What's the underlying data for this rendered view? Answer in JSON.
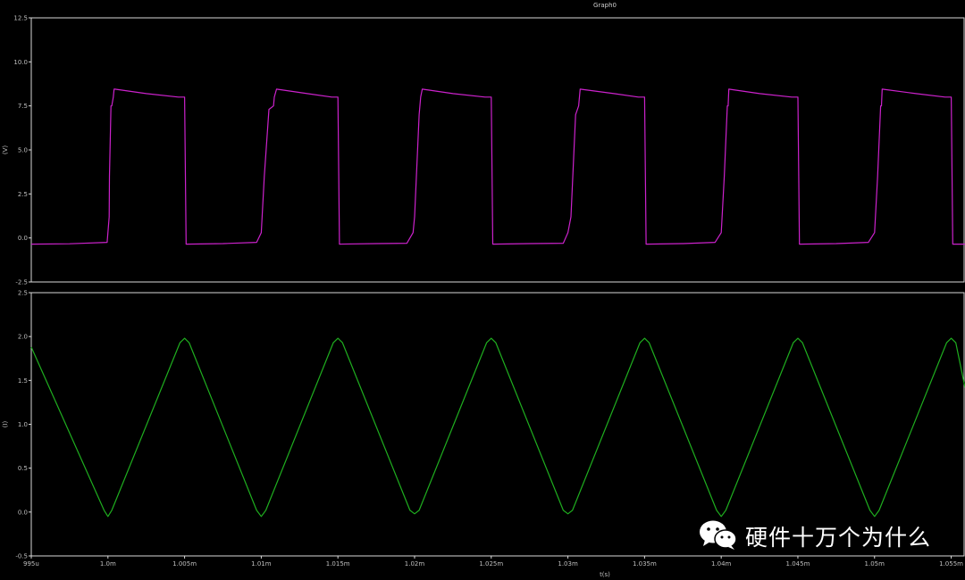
{
  "chart_data": {
    "type": "line",
    "title": "Graph0",
    "xlabel": "t(s)",
    "x_ticks": [
      "995u",
      "1.0m",
      "1.005m",
      "1.01m",
      "1.015m",
      "1.02m",
      "1.025m",
      "1.03m",
      "1.035m",
      "1.04m",
      "1.045m",
      "1.05m",
      "1.055m"
    ],
    "xlim": [
      0.000995,
      0.0010559
    ],
    "panels": [
      {
        "name": "voltage",
        "ylabel": "(V)",
        "ylim": [
          -2.5,
          12.5
        ],
        "y_ticks": [
          "12.5",
          "10.0",
          "7.5",
          "5.0",
          "2.5",
          "0.0",
          "-2.5"
        ],
        "series": [
          {
            "color": "#cc22cc",
            "x": [
              0.000995,
              0.0009975,
              0.00099995,
              0.00100008,
              0.0010001,
              0.0010002,
              0.00100025,
              0.00100035,
              0.0010004,
              0.00100045,
              0.0010025,
              0.0010046,
              0.001005,
              0.0010051,
              0.0010075,
              0.0010097,
              0.00101,
              0.0010102,
              0.0010105,
              0.0010108,
              0.00101085,
              0.001011,
              0.001013,
              0.0010146,
              0.001015,
              0.0010151,
              0.0010175,
              0.0010195,
              0.0010199,
              0.00102,
              0.0010203,
              0.0010204,
              0.0010205,
              0.0010225,
              0.0010246,
              0.001025,
              0.0010251,
              0.0010275,
              0.0010297,
              0.00103,
              0.0010302,
              0.0010305,
              0.0010307,
              0.0010308,
              0.001033,
              0.0010346,
              0.001035,
              0.0010351,
              0.0010375,
              0.0010396,
              0.00104,
              0.0010402,
              0.0010404,
              0.00104045,
              0.0010405,
              0.0010425,
              0.0010446,
              0.001045,
              0.0010451,
              0.0010475,
              0.0010496,
              0.00105,
              0.0010502,
              0.0010504,
              0.00105045,
              0.0010505,
              0.0010527,
              0.0010546,
              0.001055,
              0.0010551,
              0.0010559
            ],
            "y": [
              -0.35,
              -0.33,
              -0.25,
              1.2,
              3.5,
              7.5,
              7.5,
              8.0,
              8.45,
              8.45,
              8.2,
              8.0,
              8.0,
              -0.35,
              -0.32,
              -0.25,
              0.3,
              3.5,
              7.3,
              7.5,
              8.0,
              8.45,
              8.2,
              8.0,
              8.0,
              -0.35,
              -0.32,
              -0.3,
              0.3,
              1.2,
              7.0,
              8.0,
              8.45,
              8.2,
              8.0,
              8.0,
              -0.35,
              -0.32,
              -0.3,
              0.3,
              1.2,
              7.0,
              7.5,
              8.45,
              8.2,
              8.0,
              8.0,
              -0.35,
              -0.32,
              -0.25,
              0.3,
              3.5,
              7.5,
              7.5,
              8.45,
              8.2,
              8.0,
              8.0,
              -0.35,
              -0.32,
              -0.25,
              0.3,
              3.5,
              7.5,
              7.5,
              8.45,
              8.2,
              8.0,
              8.0,
              -0.35,
              -0.35
            ]
          }
        ]
      },
      {
        "name": "current",
        "ylabel": "(I)",
        "ylim": [
          -0.5,
          2.5
        ],
        "y_ticks": [
          "2.5",
          "2.0",
          "1.5",
          "1.0",
          "0.5",
          "0.0",
          "-0.5"
        ],
        "series": [
          {
            "color": "#1fae1f",
            "x": [
              0.000995,
              0.00099975,
              0.001,
              0.00100025,
              0.0010047,
              0.001005,
              0.0010053,
              0.0010097,
              0.00101,
              0.0010103,
              0.0010147,
              0.001015,
              0.0010153,
              0.0010197,
              0.00102,
              0.0010203,
              0.0010247,
              0.001025,
              0.0010253,
              0.0010297,
              0.00103,
              0.0010303,
              0.0010347,
              0.001035,
              0.0010353,
              0.0010397,
              0.00104,
              0.0010403,
              0.0010447,
              0.001045,
              0.0010453,
              0.0010497,
              0.00105,
              0.0010503,
              0.0010547,
              0.001055,
              0.0010553,
              0.0010559
            ],
            "y": [
              1.88,
              0.02,
              -0.05,
              0.02,
              1.93,
              1.98,
              1.93,
              0.02,
              -0.05,
              0.02,
              1.93,
              1.98,
              1.93,
              0.02,
              -0.02,
              0.02,
              1.93,
              1.98,
              1.93,
              0.02,
              -0.02,
              0.02,
              1.93,
              1.98,
              1.93,
              0.02,
              -0.05,
              0.02,
              1.93,
              1.98,
              1.93,
              0.02,
              -0.05,
              0.02,
              1.93,
              1.98,
              1.93,
              1.42
            ]
          }
        ]
      }
    ]
  },
  "watermark": {
    "text": "硬件十万个为什么",
    "icon": "wechat-icon"
  }
}
